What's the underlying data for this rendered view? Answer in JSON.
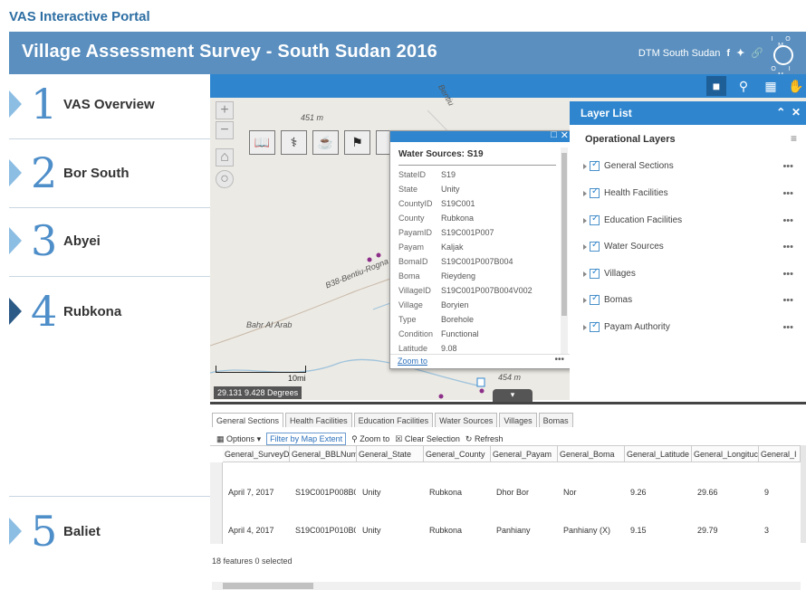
{
  "page": {
    "caption": "VAS Interactive Portal"
  },
  "banner": {
    "title": "Village Assessment Survey - South Sudan 2016",
    "org": "DTM South Sudan",
    "logo_top": "I O M",
    "logo_bottom": "O I M"
  },
  "sidebar": {
    "items": [
      {
        "num": "1",
        "label": "VAS Overview"
      },
      {
        "num": "2",
        "label": "Bor South"
      },
      {
        "num": "3",
        "label": "Abyei"
      },
      {
        "num": "4",
        "label": "Rubkona"
      },
      {
        "num": "5",
        "label": "Baliet"
      }
    ]
  },
  "map": {
    "labels": {
      "elev1": "451 m",
      "elev2": "454 m",
      "road": "B38-Bentiu-Rogna",
      "river": "Bahr Al Arab",
      "town": "Bentiu"
    },
    "scale": "10mi",
    "coords": "29.131 9.428 Degrees"
  },
  "popup": {
    "title": "Water Sources: S19",
    "fields": [
      {
        "k": "StateID",
        "v": "S19"
      },
      {
        "k": "State",
        "v": "Unity"
      },
      {
        "k": "CountyID",
        "v": "S19C001"
      },
      {
        "k": "County",
        "v": "Rubkona"
      },
      {
        "k": "PayamID",
        "v": "S19C001P007"
      },
      {
        "k": "Payam",
        "v": "Kaljak"
      },
      {
        "k": "BomaID",
        "v": "S19C001P007B004"
      },
      {
        "k": "Boma",
        "v": "Rieydeng"
      },
      {
        "k": "VillageID",
        "v": "S19C001P007B004V002"
      },
      {
        "k": "Village",
        "v": "Boryien"
      },
      {
        "k": "Type",
        "v": "Borehole"
      },
      {
        "k": "Condition",
        "v": "Functional"
      },
      {
        "k": "Latitude",
        "v": "9.08"
      }
    ],
    "zoom_to": "Zoom to",
    "more": "•••"
  },
  "layer_list": {
    "title": "Layer List",
    "section": "Operational Layers",
    "layers": [
      "General Sections",
      "Health Facilities",
      "Education Facilities",
      "Water Sources",
      "Villages",
      "Bomas",
      "Payam Authority"
    ]
  },
  "attribute_table": {
    "tabs": [
      "General Sections",
      "Health Facilities",
      "Education Facilities",
      "Water Sources",
      "Villages",
      "Bomas"
    ],
    "toolbar": {
      "options": "Options",
      "filter": "Filter by Map Extent",
      "zoom": "Zoom to",
      "clear": "Clear Selection",
      "refresh": "Refresh"
    },
    "columns": [
      "General_SurveyD",
      "General_BBLNum",
      "General_State",
      "General_County",
      "General_Payam",
      "General_Boma",
      "General_Latitude",
      "General_Longituc",
      "General_I"
    ],
    "rows": [
      [
        "April 7, 2017",
        "S19C001P008B0(",
        "Unity",
        "Rubkona",
        "Dhor Bor",
        "Nor",
        "9.26",
        "29.66",
        "9"
      ],
      [
        "April 4, 2017",
        "S19C001P010B0(",
        "Unity",
        "Rubkona",
        "Panhiany",
        "Panhiany (X)",
        "9.15",
        "29.79",
        "3"
      ]
    ],
    "footer": "18 features 0 selected"
  },
  "colors": {
    "banner": "#5a8fbf",
    "toolbar": "#2f86cf",
    "accent_number": "#4e8ec9"
  }
}
